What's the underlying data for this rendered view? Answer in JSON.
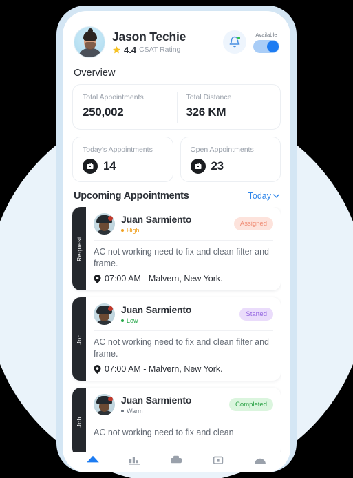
{
  "header": {
    "user_name": "Jason Techie",
    "rating_value": "4.4",
    "rating_label": "CSAT Rating",
    "star_icon": "star-icon",
    "avatar_icon": "user-avatar",
    "bell_icon": "bell-icon",
    "availability_label": "Available",
    "toggle_state": "on"
  },
  "overview": {
    "title": "Overview",
    "wide_card": [
      {
        "label": "Total Appointments",
        "value": "250,002"
      },
      {
        "label": "Total Distance",
        "value": "326 KM"
      }
    ],
    "icon_cards": [
      {
        "label": "Today's Appointments",
        "value": "14",
        "icon": "toolbox-icon"
      },
      {
        "label": "Open Appointments",
        "value": "23",
        "icon": "toolbox-icon"
      }
    ]
  },
  "upcoming": {
    "title": "Upcoming Appointments",
    "filter_label": "Today",
    "filter_icon": "chevron-down-icon",
    "appointments": [
      {
        "tab_label": "Request",
        "name": "Juan Sarmiento",
        "priority": "High",
        "priority_color": "#f0a020",
        "status": "Assigned",
        "status_bg": "#fde3dc",
        "status_color": "#ef8a72",
        "description": "AC not working need to fix and clean filter and frame.",
        "time_location": "07:00 AM - Malvern, New York.",
        "location_icon": "location-pin-icon"
      },
      {
        "tab_label": "Job",
        "name": "Juan Sarmiento",
        "priority": "Low",
        "priority_color": "#27a84a",
        "status": "Started",
        "status_bg": "#eadcfb",
        "status_color": "#9466e0",
        "description": "AC not working need to fix and clean filter and frame.",
        "time_location": "07:00 AM - Malvern, New York.",
        "location_icon": "location-pin-icon"
      },
      {
        "tab_label": "Job",
        "name": "Juan Sarmiento",
        "priority": "Warm",
        "priority_color": "#6f7782",
        "status": "Completed",
        "status_bg": "#dbf5de",
        "status_color": "#2aa145",
        "description": "AC not working need to fix and clean",
        "time_location": "",
        "location_icon": "location-pin-icon"
      }
    ]
  },
  "bottom_nav": {
    "items": [
      {
        "icon": "home-icon",
        "active": true
      },
      {
        "icon": "chart-icon",
        "active": false
      },
      {
        "icon": "inbox-icon",
        "active": false
      },
      {
        "icon": "calendar-icon",
        "active": false
      },
      {
        "icon": "profile-icon",
        "active": false
      }
    ],
    "active_color": "#1d7cf2",
    "inactive_color": "#9aa1ab"
  },
  "theme": {
    "background_circle": "#eaf3fa",
    "phone_frame": "#d4e6f4",
    "accent_blue": "#2f86ea"
  }
}
